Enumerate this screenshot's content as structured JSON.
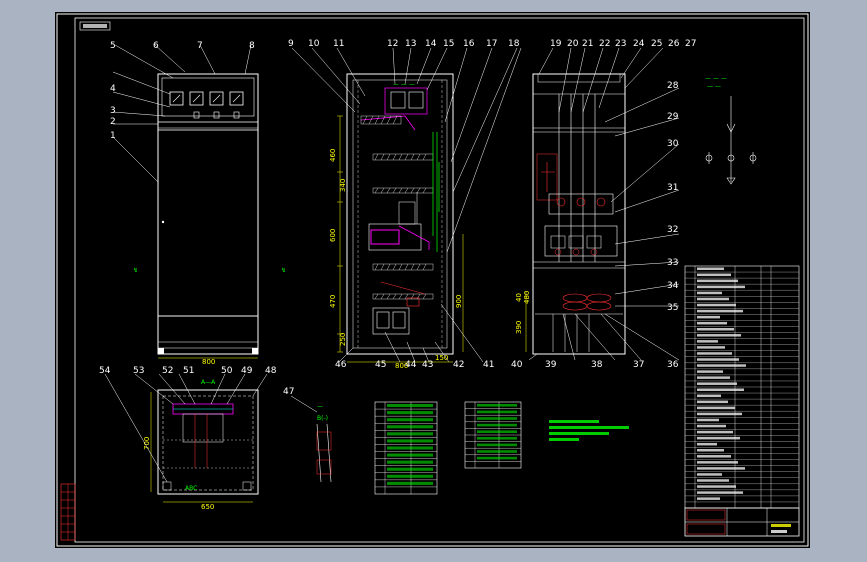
{
  "drawing": {
    "background": "#000000",
    "border_color": "#ffffff",
    "line_color": "#ffffff",
    "dim_color": "#ffff00",
    "annotation_color": "#00ff00",
    "highlight_color": "#ff00ff",
    "red_color": "#ff3030",
    "cyan_color": "#00ffff"
  },
  "front_view": {
    "callouts": [
      "1",
      "2",
      "3",
      "4",
      "5",
      "6",
      "7",
      "8"
    ],
    "width_dim": "800"
  },
  "section_view": {
    "callouts_top": [
      "9",
      "10",
      "11",
      "12",
      "13",
      "14",
      "15",
      "16",
      "17",
      "18"
    ],
    "callouts_bottom": [
      "41",
      "42",
      "43",
      "44",
      "45",
      "46"
    ],
    "dims_left": [
      "460",
      "340",
      "600",
      "470",
      "250"
    ],
    "dims_right": [
      "900"
    ],
    "dims_bottom": [
      "800",
      "150"
    ]
  },
  "side_view": {
    "callouts_top": [
      "19",
      "20",
      "21",
      "22",
      "23",
      "24",
      "25",
      "26",
      "27"
    ],
    "callouts_right": [
      "28",
      "29",
      "30",
      "31",
      "32",
      "33",
      "34",
      "35",
      "36",
      "37",
      "38",
      "39",
      "40"
    ],
    "dims_left": [
      "40",
      "480",
      "390"
    ]
  },
  "plan_view": {
    "callouts": [
      "48",
      "49",
      "50",
      "51",
      "52",
      "53",
      "54"
    ],
    "dims": [
      "700",
      "650"
    ]
  },
  "detail": {
    "callout": "47"
  },
  "left_strip_label": "",
  "tables": {
    "table1_rows": 13,
    "table2_rows": 10
  }
}
